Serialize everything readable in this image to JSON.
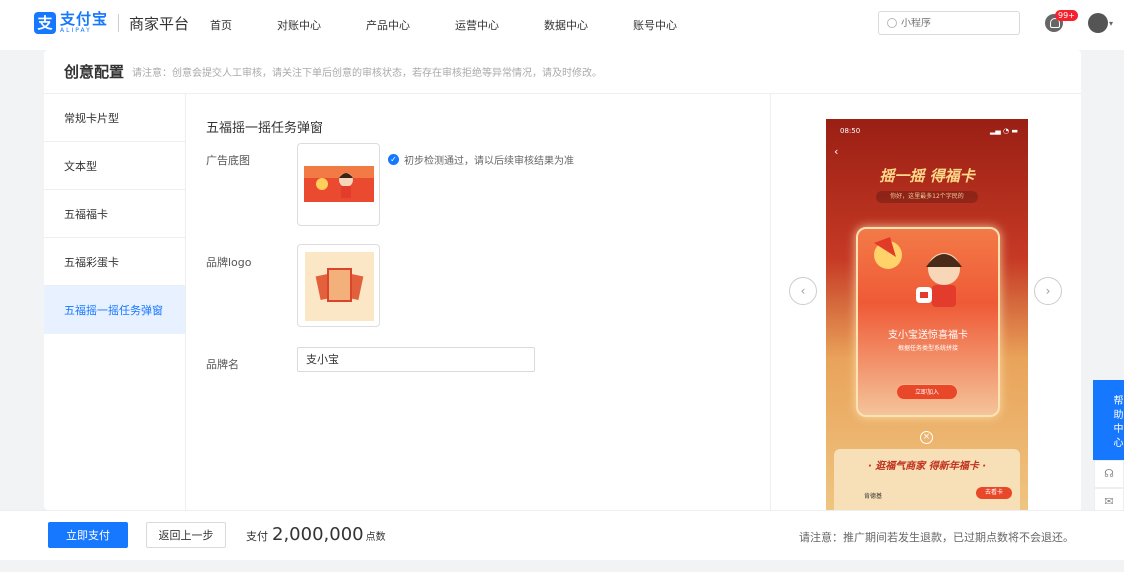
{
  "header": {
    "logo_cn": "支付宝",
    "logo_en": "ALIPAY",
    "platform": "商家平台",
    "nav": [
      "首页",
      "对账中心",
      "产品中心",
      "运营中心",
      "数据中心",
      "账号中心"
    ],
    "search_placeholder": "小程序",
    "notification_badge": "99+"
  },
  "page": {
    "title": "创意配置",
    "note": "请注意：创意会提交人工审核，请关注下单后创意的审核状态，若存在审核拒绝等异常情况，请及时修改。"
  },
  "sidebar": {
    "items": [
      "常规卡片型",
      "文本型",
      "五福福卡",
      "五福彩蛋卡",
      "五福摇一摇任务弹窗"
    ],
    "active_index": 4
  },
  "form": {
    "section_title": "五福摇一摇任务弹窗",
    "ad_image_label": "广告底图",
    "check_text": "初步检测通过，请以后续审核结果为准",
    "brand_logo_label": "品牌logo",
    "brand_name_label": "品牌名",
    "brand_name_value": "支小宝"
  },
  "preview": {
    "status_time": "08:50",
    "headline": "摇一摇 得福卡",
    "sub": "你好，这里最多12个字民的",
    "modal_title": "支小宝送惊喜福卡",
    "modal_sub": "根据任务类型系统拼接",
    "modal_button": "立即加入",
    "banner_title": "· 逛福气商家 得新年福卡 ·",
    "row_name": "肯德基",
    "row_button": "去看卡"
  },
  "help": {
    "label": "帮助中心"
  },
  "footer": {
    "pay_button": "立即支付",
    "back_button": "返回上一步",
    "pay_prefix": "支付",
    "pay_amount": "2,000,000",
    "pay_unit": "点数",
    "note": "请注意：推广期间若发生退款，已过期点数将不会退还。"
  },
  "colors": {
    "primary": "#1677ff",
    "active_bg": "#e8f1ff",
    "badge": "#f5222d"
  }
}
